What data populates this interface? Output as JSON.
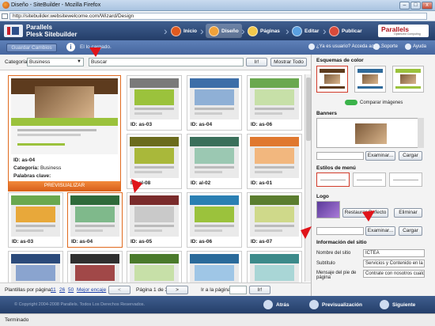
{
  "window": {
    "title": "Diseño - SiteBuilder - Mozilla Firefox",
    "url": "http://sitebuilder.websitewelcome.com/Wizard/Design"
  },
  "header": {
    "brand_line1": "Parallels",
    "brand_line2": "Plesk Sitebuilder",
    "steps": [
      "Inicio",
      "Diseño",
      "Páginas",
      "Editar",
      "Publicar"
    ],
    "active_step": "Diseño",
    "vendor": "Parallels",
    "vendor_tag": "Optimized Computing"
  },
  "subbar": {
    "save_label": "Guardar Cambios",
    "message": "El lo    cargado.",
    "account": "¿Ya es usuario? Acceda aquí...",
    "support": "Soporte",
    "help": "Ayuda"
  },
  "filter": {
    "category_label": "Categoría",
    "category_value": "Business",
    "search_value": "Buscar",
    "go_label": "Ir!",
    "show_all_label": "Mostrar Todo"
  },
  "featured": {
    "id_label": "ID:",
    "id": "as-04",
    "category_label": "Categoría:",
    "category": "Business",
    "keywords_label": "Palabras clave:",
    "preview_label": "PREVISUALIZAR"
  },
  "templates": [
    {
      "id": "as-03",
      "c1": "#7a7a7a",
      "c2": "#9bc23c"
    },
    {
      "id": "as-04",
      "c1": "#3d6ea8",
      "c2": "#8fb0d6"
    },
    {
      "id": "as-06",
      "c1": "#6aa84f",
      "c2": "#c7e0a8"
    },
    {
      "id": "al-08",
      "c1": "#6b6b1d",
      "c2": "#a9b83a"
    },
    {
      "id": "al-02",
      "c1": "#3a6f5a",
      "c2": "#9bc8b2"
    },
    {
      "id": "as-01",
      "c1": "#e0782f",
      "c2": "#f2b77e"
    },
    {
      "id": "as-03",
      "c1": "#6aa84f",
      "c2": "#e8a83a"
    },
    {
      "id": "as-04",
      "c1": "#2f6a3a",
      "c2": "#7fb98b"
    },
    {
      "id": "as-05",
      "c1": "#7a2b2b",
      "c2": "#c9c9c9"
    },
    {
      "id": "as-06",
      "c1": "#2a7fb3",
      "c2": "#9bc23c"
    },
    {
      "id": "as-07",
      "c1": "#5b7d2f",
      "c2": "#cfd98a"
    },
    {
      "id": "",
      "c1": "#2b4a7a",
      "c2": "#8aa4cf"
    },
    {
      "id": "",
      "c1": "#2f2f2f",
      "c2": "#a14848"
    },
    {
      "id": "",
      "c1": "#4a7a2b",
      "c2": "#c7e0a8"
    },
    {
      "id": "",
      "c1": "#2a6a9a",
      "c2": "#9fc6e6"
    },
    {
      "id": "",
      "c1": "#3c8a8a",
      "c2": "#a9d6d6"
    }
  ],
  "id_prefix": "ID:",
  "pager": {
    "per_page_label": "Plantillas por página:",
    "opt1": "11",
    "opt2": "26",
    "opt3": "50",
    "best": "Mejor encaje",
    "prev_label": "<",
    "page_of": "Página 1 de 3",
    "next_label": ">",
    "goto_label": "Ir a la página",
    "go_label": "Ir!"
  },
  "right": {
    "schemes_title": "Esquemas de color",
    "scheme_colors": [
      "#5d3b1e",
      "#2f6a9a",
      "#9bc23c"
    ],
    "compare_label": "Comparar imágenes",
    "banners_title": "Banners",
    "browse_label": "Examinar...",
    "upload_label": "Cargar",
    "menu_title": "Estilos de menú",
    "logo_title": "Logo",
    "restore_label": "Restaurar Defecto",
    "delete_label": "Eliminar",
    "logo_browse_label": "Examinar...",
    "logo_upload_label": "Cargar",
    "site_title": "Información del sitio",
    "site_name_label": "Nombre del sitio",
    "site_name": "ICTEA",
    "subtitle_label": "Subtítulo",
    "subtitle": "Servicios y Contenido en la Web",
    "footer_msg_label": "Mensaje del pie de página",
    "footer_msg": "Contrate con nosotros cualquier"
  },
  "footer": {
    "copyright": "© Copyright 2004-2008 Parallels. Todos Los Derechos Reservados.",
    "back": "Atrás",
    "preview": "Previsualización",
    "next": "Siguiente"
  },
  "status": "Terminado",
  "colors": {
    "accent_blue": "#2b4a7a",
    "orange": "#e06a1f",
    "arrow_red": "#e0141a"
  }
}
